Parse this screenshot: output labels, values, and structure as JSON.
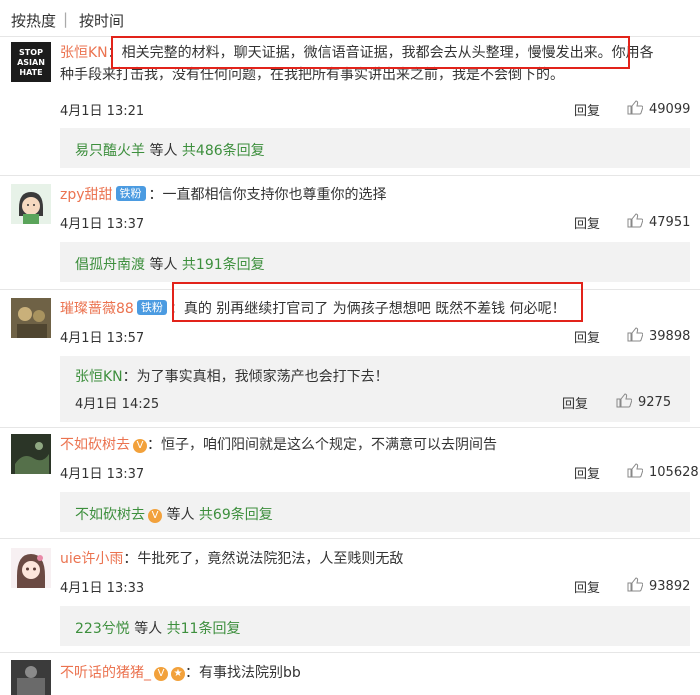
{
  "sort": {
    "hot": "按热度",
    "sep": "|",
    "time": "按时间"
  },
  "colors": {
    "user": "#eb7350",
    "reply_link": "#3d8f3d",
    "highlight": "#e2231a"
  },
  "comments": [
    {
      "user": "张恒KN",
      "avatar_text": "STOP ASIAN HATE",
      "text_line1": "：相关完整的材料，聊天证据，微信语音证据，我都会去从头整理，慢慢发出来。你用各",
      "text_line2": "种手段来打击我，没有任何问题，在我把所有事实讲出来之前，我是不会倒下的。",
      "date": "4月1日 13:21",
      "reply": "回复",
      "likes": "49099",
      "sub_user": "易只醢火羊",
      "sub_mid": "等人",
      "sub_count": "共486条回复"
    },
    {
      "user": "zpy甜甜",
      "badge": "铁粉",
      "text": "：一直都相信你支持你也尊重你的选择",
      "date": "4月1日 13:37",
      "reply": "回复",
      "likes": "47951",
      "sub_user": "倡孤舟南渡",
      "sub_mid": "等人",
      "sub_count": "共191条回复"
    },
    {
      "user": "璀璨蔷薇88",
      "badge": "铁粉",
      "text": "：真的 别再继续打官司了 为俩孩子想想吧 既然不差钱 何必呢！",
      "date": "4月1日 13:57",
      "reply": "回复",
      "likes": "39898",
      "reply_user": "张恒KN",
      "reply_text": "：为了事实真相，我倾家荡产也会打下去！",
      "reply_date": "4月1日 14:25",
      "reply_reply": "回复",
      "reply_likes": "9275"
    },
    {
      "user": "不如砍树去",
      "text": "：恒子，咱们阳间就是这么个规定，不满意可以去阴间告",
      "date": "4月1日 13:37",
      "reply": "回复",
      "likes": "105628",
      "sub_user": "不如砍树去",
      "sub_mid": "等人",
      "sub_count": "共69条回复"
    },
    {
      "user": "uie许小雨",
      "text": "：牛批死了，竟然说法院犯法，人至贱则无敌",
      "date": "4月1日 13:33",
      "reply": "回复",
      "likes": "93892",
      "sub_user": "223兮悦",
      "sub_mid": "等人",
      "sub_count": "共11条回复"
    },
    {
      "user": "不听话的猪猪_",
      "text": "：有事找法院别bb"
    }
  ]
}
